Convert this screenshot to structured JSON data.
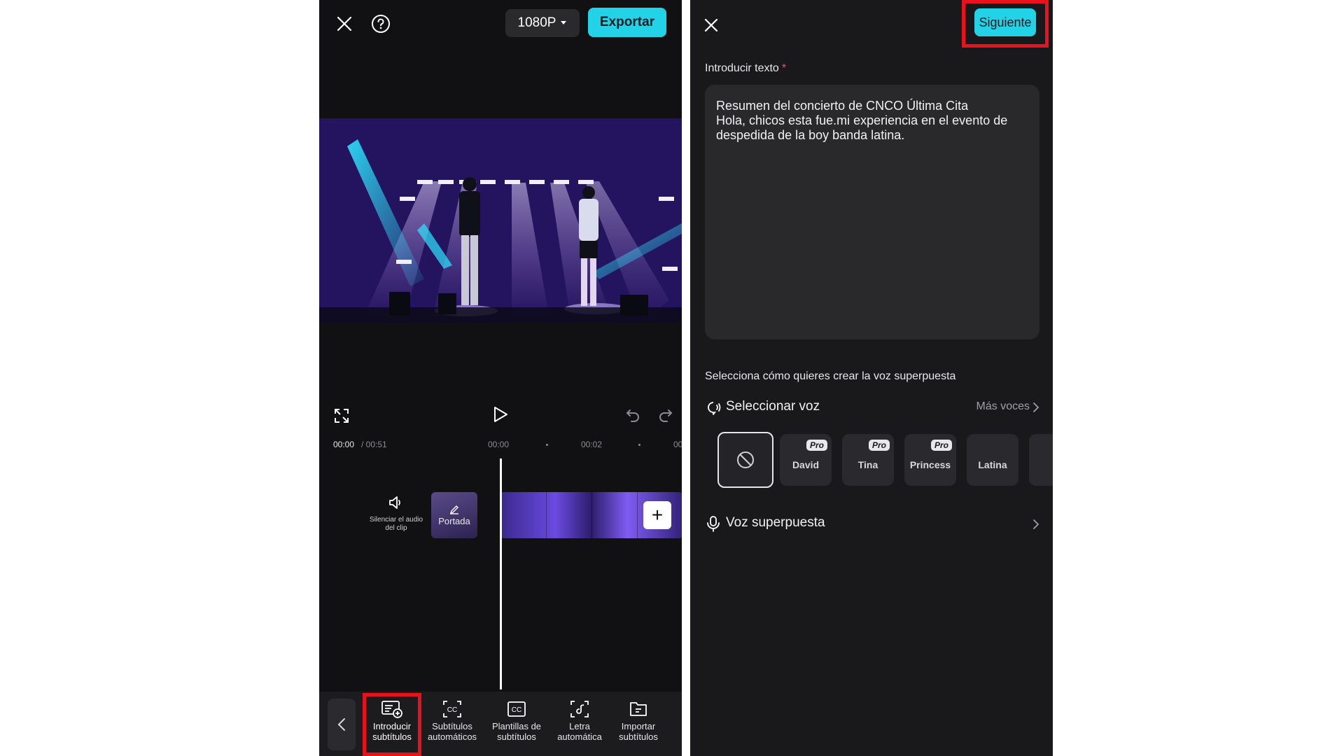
{
  "editor": {
    "resolution": "1080P",
    "export_label": "Exportar",
    "time_current": "00:00",
    "time_total": "/ 00:51",
    "ruler_ticks": [
      "00:00",
      "00:02",
      "00"
    ],
    "mute_label": "Silenciar el audio del clip",
    "cover_label": "Portada",
    "add_symbol": "+",
    "tools": [
      {
        "label": "Introducir subtítulos",
        "icon": "text-add-icon"
      },
      {
        "label": "Subtítulos automáticos",
        "icon": "auto-captions-icon"
      },
      {
        "label": "Plantillas de subtítulos",
        "icon": "caption-templates-icon"
      },
      {
        "label": "Letra automática",
        "icon": "auto-lyrics-icon"
      },
      {
        "label": "Importar subtítulos",
        "icon": "import-captions-icon"
      }
    ]
  },
  "tts": {
    "next_label": "Siguiente",
    "input_label": "Introducir texto",
    "required_mark": "*",
    "input_text": "Resumen del concierto de CNCO Última Cita\nHola, chicos esta fue.mi experiencia en el evento de despedida de la boy banda latina.",
    "select_prompt": "Selecciona cómo quieres crear la voz superpuesta",
    "select_voice_label": "Seleccionar voz",
    "more_voices_label": "Más voces",
    "pro_badge": "Pro",
    "voices": [
      {
        "name": "David",
        "pro": true
      },
      {
        "name": "Tina",
        "pro": true
      },
      {
        "name": "Princess",
        "pro": true
      },
      {
        "name": "Latina",
        "pro": false
      }
    ],
    "overlay_label": "Voz superpuesta"
  },
  "colors": {
    "accent": "#22d3e8",
    "highlight": "#e8111c",
    "background": "#111113"
  }
}
